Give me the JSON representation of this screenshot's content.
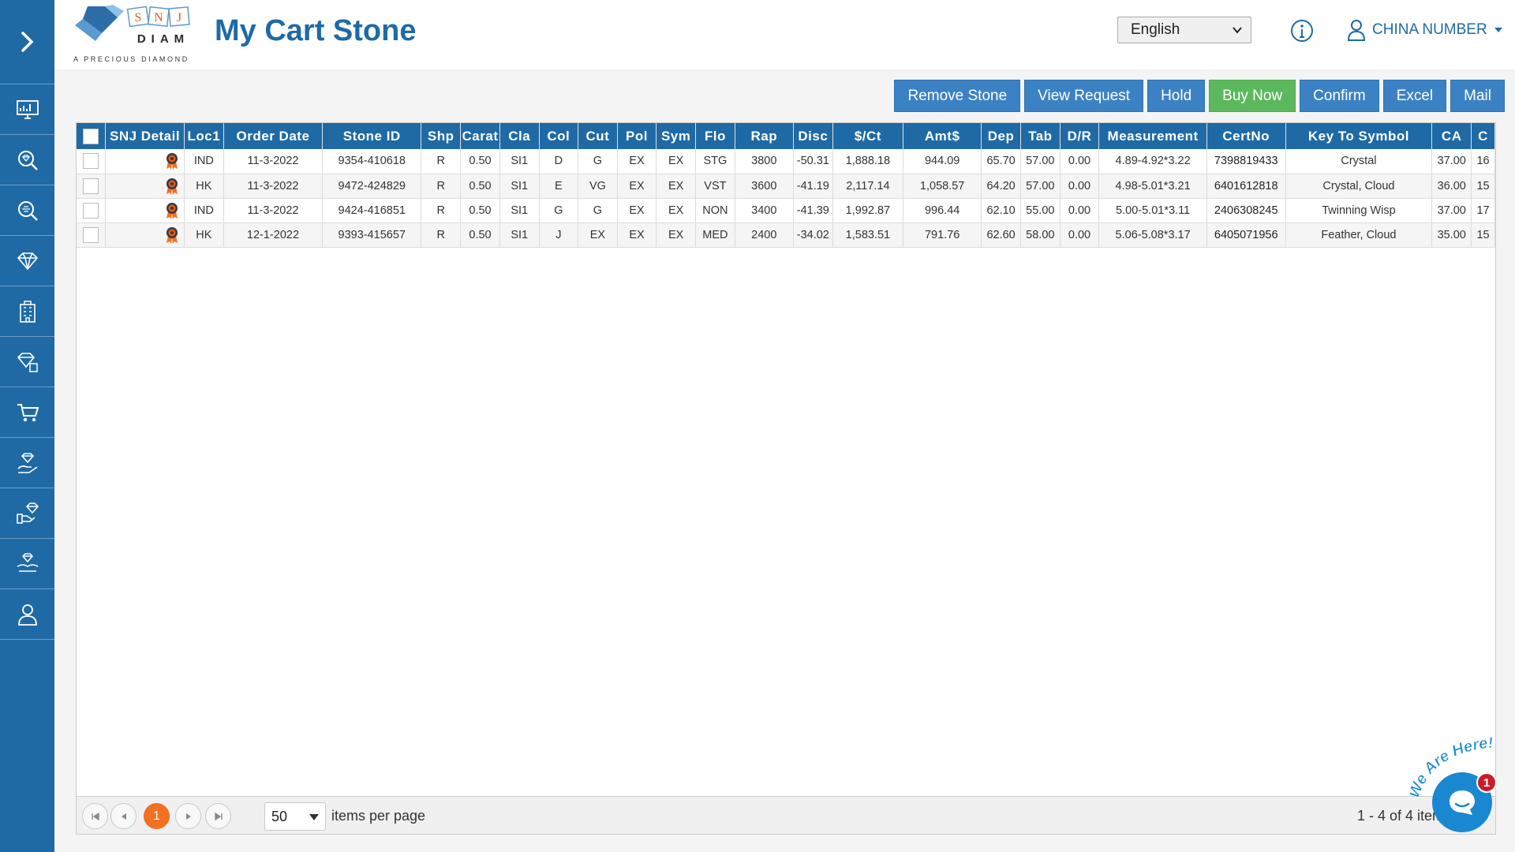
{
  "app": {
    "page_title": "My Cart Stone",
    "logo": {
      "letters": [
        "S",
        "N",
        "J"
      ],
      "word": "DIAM",
      "tagline": "A PRECIOUS DIAMOND"
    }
  },
  "header": {
    "language": "English",
    "user_name": "CHINA NUMBER"
  },
  "sidebar": {
    "items": [
      {
        "icon": "monitor-chart-icon"
      },
      {
        "icon": "diamond-search-icon"
      },
      {
        "icon": "diamond-search-alt-icon"
      },
      {
        "icon": "diamond-icon"
      },
      {
        "icon": "building-icon"
      },
      {
        "icon": "diamond-tag-icon"
      },
      {
        "icon": "cart-icon"
      },
      {
        "icon": "diamond-hand-icon"
      },
      {
        "icon": "diamond-hand-give-icon"
      },
      {
        "icon": "diamond-hand-receive-icon"
      },
      {
        "icon": "user-support-icon"
      }
    ]
  },
  "toolbar": {
    "remove_stone": "Remove Stone",
    "view_request": "View Request",
    "hold": "Hold",
    "buy_now": "Buy Now",
    "confirm": "Confirm",
    "excel": "Excel",
    "mail": "Mail"
  },
  "table": {
    "columns": [
      "SNJ Detail",
      "Loc1",
      "Order Date",
      "Stone ID",
      "Shp",
      "Carat",
      "Cla",
      "Col",
      "Cut",
      "Pol",
      "Sym",
      "Flo",
      "Rap",
      "Disc",
      "$/Ct",
      "Amt$",
      "Dep",
      "Tab",
      "D/R",
      "Measurement",
      "CertNo",
      "Key To Symbol",
      "CA",
      "C"
    ],
    "rows": [
      {
        "loc": "IND",
        "date": "11-3-2022",
        "stone_id": "9354-410618",
        "shp": "R",
        "carat": "0.50",
        "cla": "SI1",
        "col": "D",
        "cut": "G",
        "pol": "EX",
        "sym": "EX",
        "flo": "STG",
        "rap": "3800",
        "disc": "-50.31",
        "per_ct": "1,888.18",
        "amt": "944.09",
        "dep": "65.70",
        "tab": "57.00",
        "dr": "0.00",
        "measurement": "4.89-4.92*3.22",
        "cert": "7398819433",
        "key": "Crystal",
        "ca": "37.00",
        "c": "16"
      },
      {
        "loc": "HK",
        "date": "11-3-2022",
        "stone_id": "9472-424829",
        "shp": "R",
        "carat": "0.50",
        "cla": "SI1",
        "col": "E",
        "cut": "VG",
        "pol": "EX",
        "sym": "EX",
        "flo": "VST",
        "rap": "3600",
        "disc": "-41.19",
        "per_ct": "2,117.14",
        "amt": "1,058.57",
        "dep": "64.20",
        "tab": "57.00",
        "dr": "0.00",
        "measurement": "4.98-5.01*3.21",
        "cert": "6401612818",
        "key": "Crystal, Cloud",
        "ca": "36.00",
        "c": "15"
      },
      {
        "loc": "IND",
        "date": "11-3-2022",
        "stone_id": "9424-416851",
        "shp": "R",
        "carat": "0.50",
        "cla": "SI1",
        "col": "G",
        "cut": "G",
        "pol": "EX",
        "sym": "EX",
        "flo": "NON",
        "rap": "3400",
        "disc": "-41.39",
        "per_ct": "1,992.87",
        "amt": "996.44",
        "dep": "62.10",
        "tab": "55.00",
        "dr": "0.00",
        "measurement": "5.00-5.01*3.11",
        "cert": "2406308245",
        "key": "Twinning Wisp",
        "ca": "37.00",
        "c": "17"
      },
      {
        "loc": "HK",
        "date": "12-1-2022",
        "stone_id": "9393-415657",
        "shp": "R",
        "carat": "0.50",
        "cla": "SI1",
        "col": "J",
        "cut": "EX",
        "pol": "EX",
        "sym": "EX",
        "flo": "MED",
        "rap": "2400",
        "disc": "-34.02",
        "per_ct": "1,583.51",
        "amt": "791.76",
        "dep": "62.60",
        "tab": "58.00",
        "dr": "0.00",
        "measurement": "5.06-5.08*3.17",
        "cert": "6405071956",
        "key": "Feather, Cloud",
        "ca": "35.00",
        "c": "15"
      }
    ]
  },
  "pager": {
    "current_page": "1",
    "page_size": "50",
    "items_per_page_label": "items per page",
    "range_text": "1 - 4 of 4 items"
  },
  "chat": {
    "label": "We Are Here!",
    "badge": "1"
  },
  "colors": {
    "primary": "#1f6aa5",
    "button": "#3b82c4",
    "buy_now": "#5cb85c",
    "active_page": "#f36f21"
  }
}
